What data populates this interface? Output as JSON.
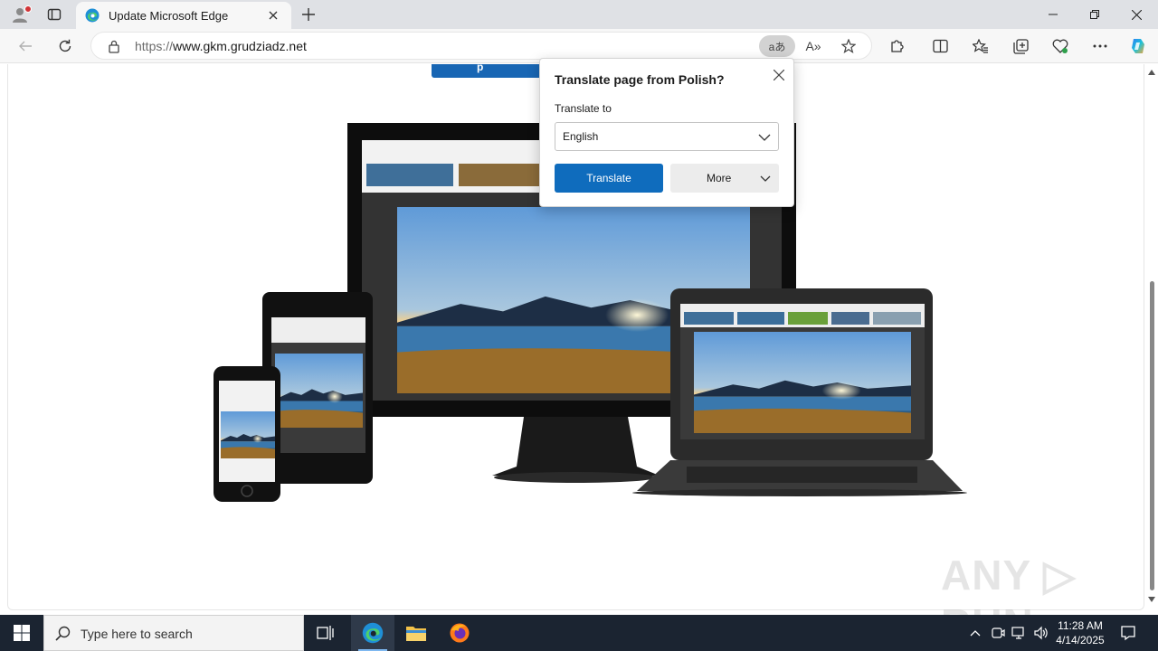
{
  "browser": {
    "tab": {
      "title": "Update Microsoft Edge",
      "favicon": "edge-icon"
    },
    "address": {
      "scheme": "https://",
      "host": "www.gkm.grudziadz.net"
    },
    "translate_pill": "aあ",
    "read_aloud": "A»"
  },
  "page": {
    "cta_text": "p",
    "watermark": "ANY ▷ RUN",
    "hero_image": "devices-landscape-illustration"
  },
  "translate_popup": {
    "title": "Translate page from Polish?",
    "label": "Translate to",
    "selected_language": "English",
    "translate_button": "Translate",
    "more_button": "More"
  },
  "taskbar": {
    "search_placeholder": "Type here to search",
    "time": "11:28 AM",
    "date": "4/14/2025"
  },
  "colors": {
    "accent": "#0f6cbd",
    "taskbar": "#1b2431",
    "tabbar": "#dfe1e5"
  }
}
